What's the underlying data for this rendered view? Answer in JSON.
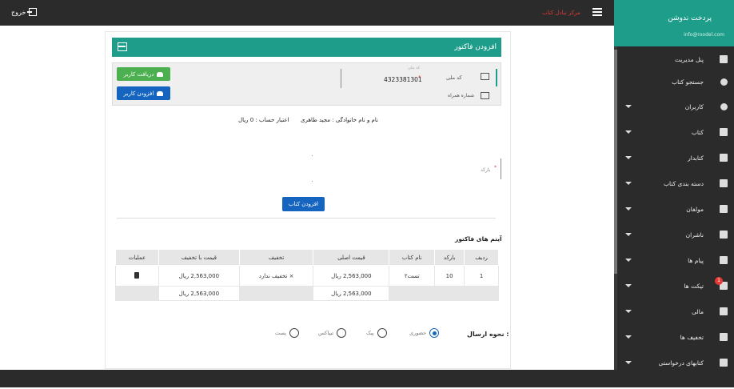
{
  "topbar": {
    "logout_label": "خروج",
    "red_text": "مرکز تبادل کتاب"
  },
  "sidebar": {
    "title": "پردخت ندوشن",
    "email": "info@roodel.com",
    "items": [
      {
        "label": "پنل مدیریت",
        "icon": "dashboard-icon",
        "has_caret": false
      },
      {
        "label": "جستجو کتاب",
        "icon": "search-icon",
        "has_caret": false
      },
      {
        "label": "کاربران",
        "icon": "person-icon",
        "has_caret": true
      },
      {
        "label": "کتاب",
        "icon": "book-icon",
        "has_caret": true
      },
      {
        "label": "کتابدار",
        "icon": "librarian-icon",
        "has_caret": true
      },
      {
        "label": "دسته بندی کتاب",
        "icon": "category-icon",
        "has_caret": true
      },
      {
        "label": "مولفان",
        "icon": "authors-icon",
        "has_caret": true
      },
      {
        "label": "ناشران",
        "icon": "building-icon",
        "has_caret": true
      },
      {
        "label": "پیام ها",
        "icon": "message-icon",
        "has_caret": true
      },
      {
        "label": "تیکت ها",
        "icon": "ticket-icon",
        "has_caret": true,
        "badge": "1"
      },
      {
        "label": "مالی",
        "icon": "finance-icon",
        "has_caret": true
      },
      {
        "label": "تخفیف ها",
        "icon": "discount-icon",
        "has_caret": true
      },
      {
        "label": "کتابهای درخواستی",
        "icon": "requested-books-icon",
        "has_caret": true
      }
    ]
  },
  "card": {
    "title": "افزودن فاکتور",
    "btn_receive": "دریافت کاربر",
    "btn_add_user": "افزودن کاربر",
    "code_small": "کد ملی",
    "code_label": "کد ملی",
    "code_value": "4323381301",
    "card_number_label": "شماره همراه",
    "name_label": "نام و نام خانوادگی : مجید طاهری",
    "credit_label": "اعتبار حساب : 0 ریال",
    "barcode_label": "بارکد",
    "add_book_label": "افزودن کتاب",
    "items_title": "آیتم های فاکتور"
  },
  "table": {
    "headers": [
      "ردیف",
      "بارکد",
      "نام کتاب",
      "قیمت اصلی",
      "تخفیف",
      "قیمت با تخفیف",
      "عملیات"
    ],
    "rows": [
      {
        "index": "1",
        "barcode": "10",
        "name": "تست۲",
        "price": "2,563,000 ریال",
        "discount": "× تخفیف ندارد",
        "final": "2,563,000 ریال"
      }
    ],
    "sum_price": "2,563,000 ریال",
    "sum_final": "2,563,000 ریال"
  },
  "shipping": {
    "label": "نحوه ارسال :",
    "options": [
      "حضوری",
      "تیپاکس",
      "پیک",
      "پست"
    ],
    "selected": "حضوری"
  },
  "colors": {
    "teal": "#1e9e8a",
    "blue": "#1565c0",
    "green": "#4caf50",
    "dark": "#2b2b2b",
    "red": "#e53935"
  }
}
